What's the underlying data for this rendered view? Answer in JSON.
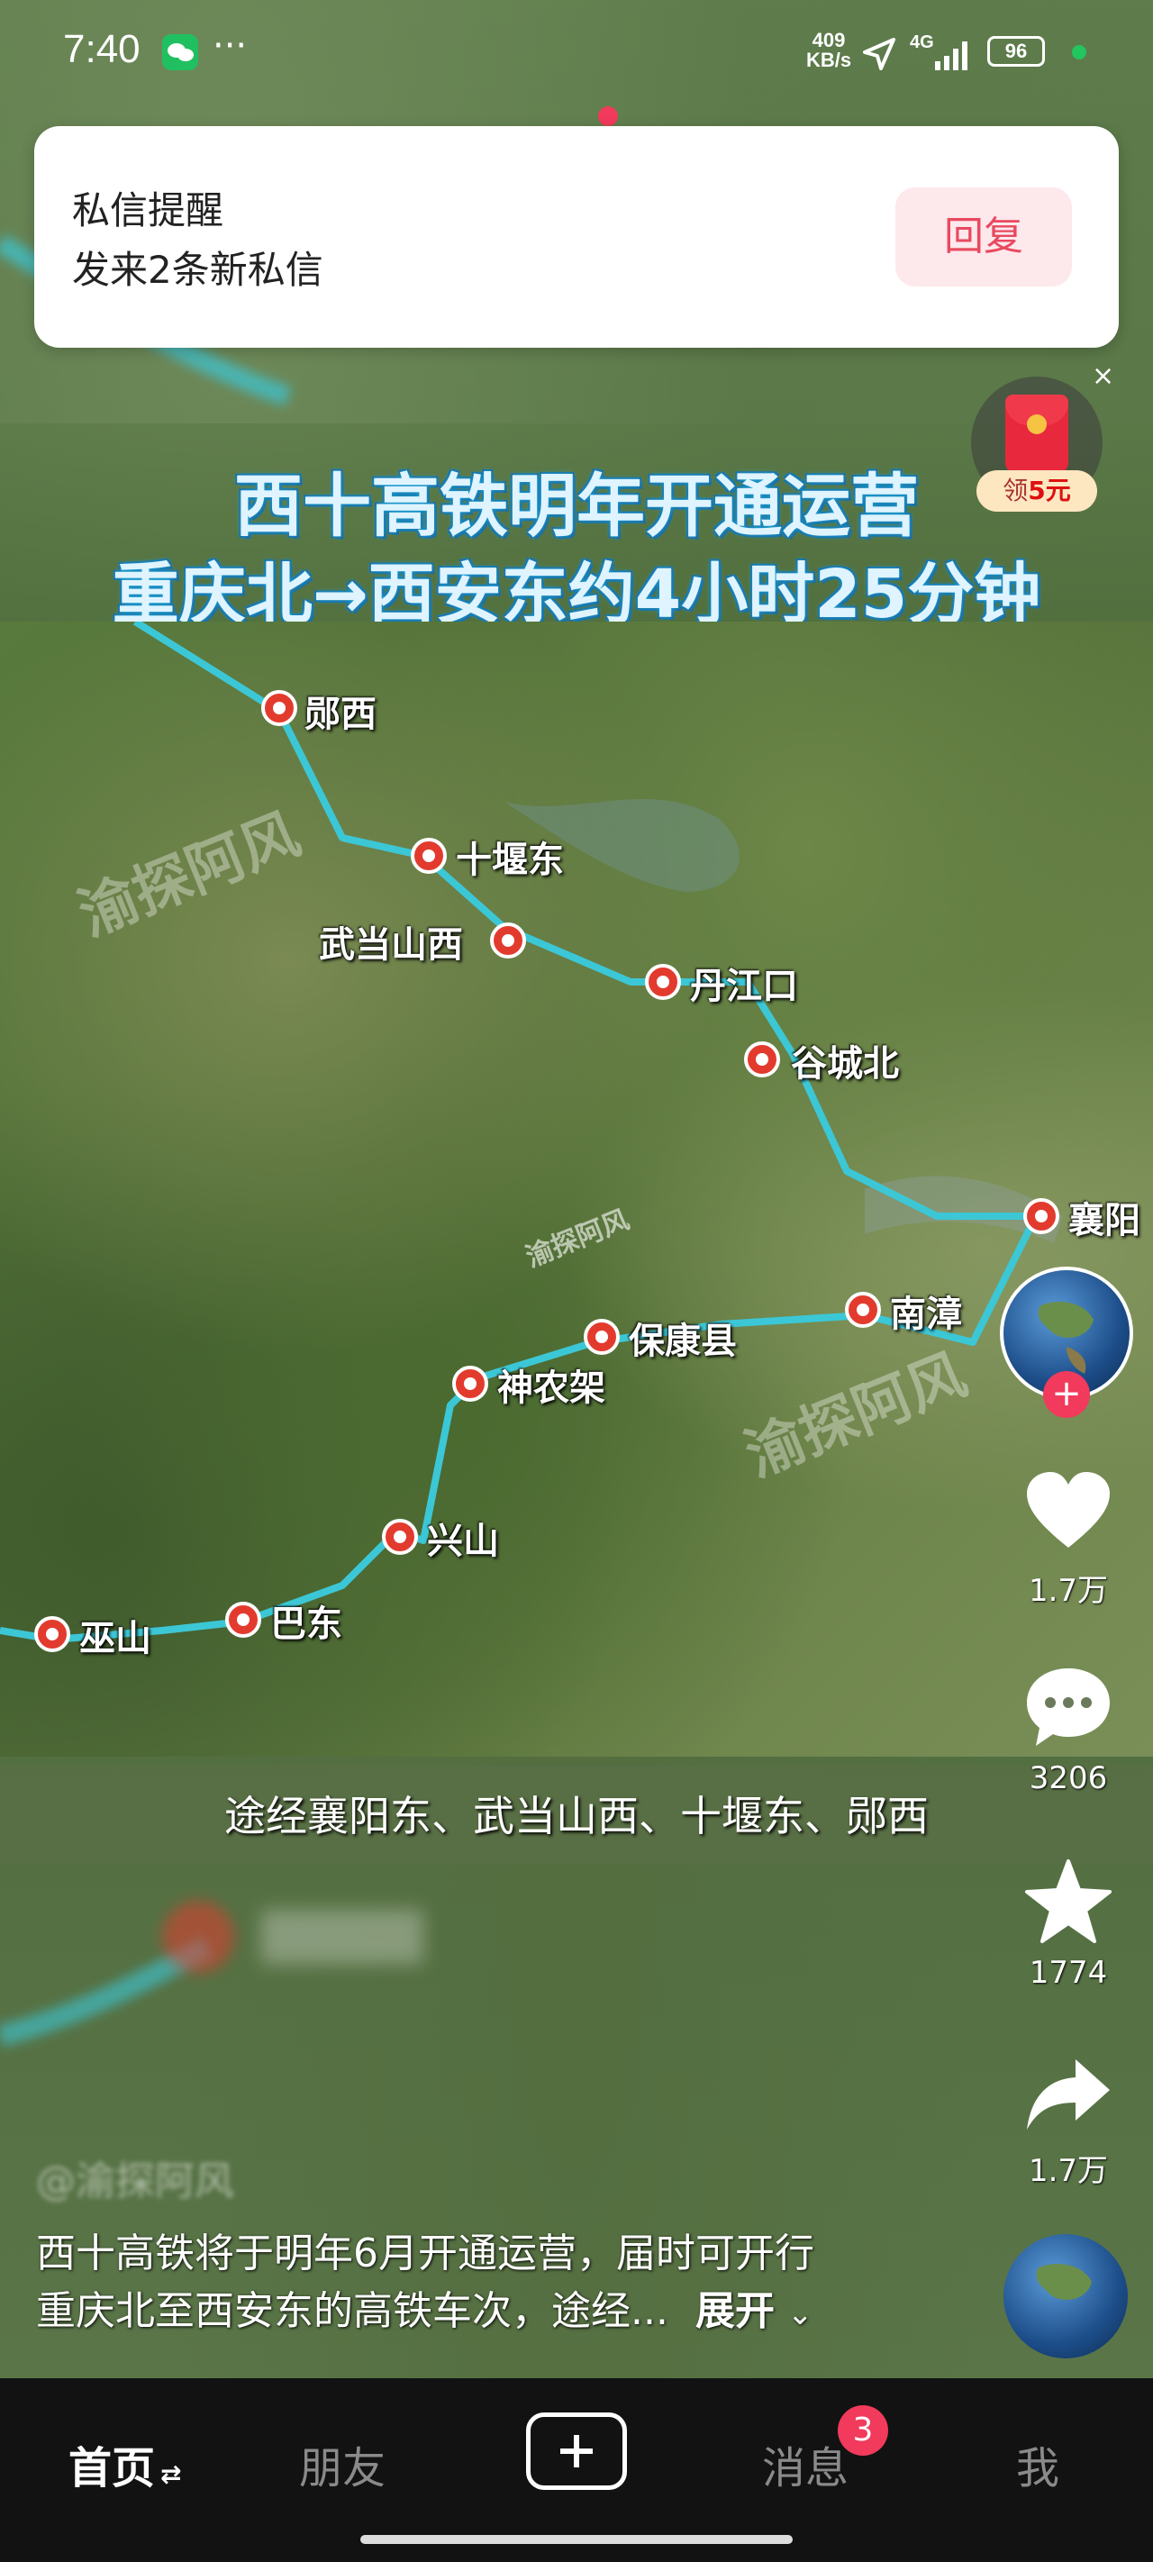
{
  "status_bar": {
    "time": "7:40",
    "dots": "···",
    "net_speed_top": "409",
    "net_speed_bottom": "KB/s",
    "network": "4G",
    "battery": "96"
  },
  "notification": {
    "title": "私信提醒",
    "body": "发来2条新私信",
    "reply_label": "回复"
  },
  "red_packet": {
    "label_prefix": "领",
    "amount": "5元"
  },
  "video": {
    "title_line1": "西十高铁明年开通运营",
    "title_line2": "重庆北→西安东约4小时25分钟",
    "caption": "途经襄阳东、武当山西、十堰东、郧西",
    "watermark": "渝探阿风",
    "stations": [
      "郧西",
      "十堰东",
      "武当山西",
      "丹江口",
      "谷城北",
      "襄阳",
      "南漳",
      "保康县",
      "神农架",
      "兴山",
      "巴东",
      "巫山"
    ]
  },
  "actions": {
    "likes": "1.7万",
    "comments": "3206",
    "favorites": "1774",
    "shares": "1.7万"
  },
  "description": {
    "author": "@渝探阿风",
    "line1": "西十高铁将于明年6月开通运营，届时可开行",
    "line2": "重庆北至西安东的高铁车次，途经...",
    "expand": "展开"
  },
  "nav": {
    "home": "首页",
    "friends": "朋友",
    "messages": "消息",
    "messages_badge": "3",
    "me": "我"
  },
  "colors": {
    "route": "#3cc7d6",
    "station": "#e23b2e",
    "reply_text": "#e8495f",
    "badge": "#f23a5c"
  }
}
